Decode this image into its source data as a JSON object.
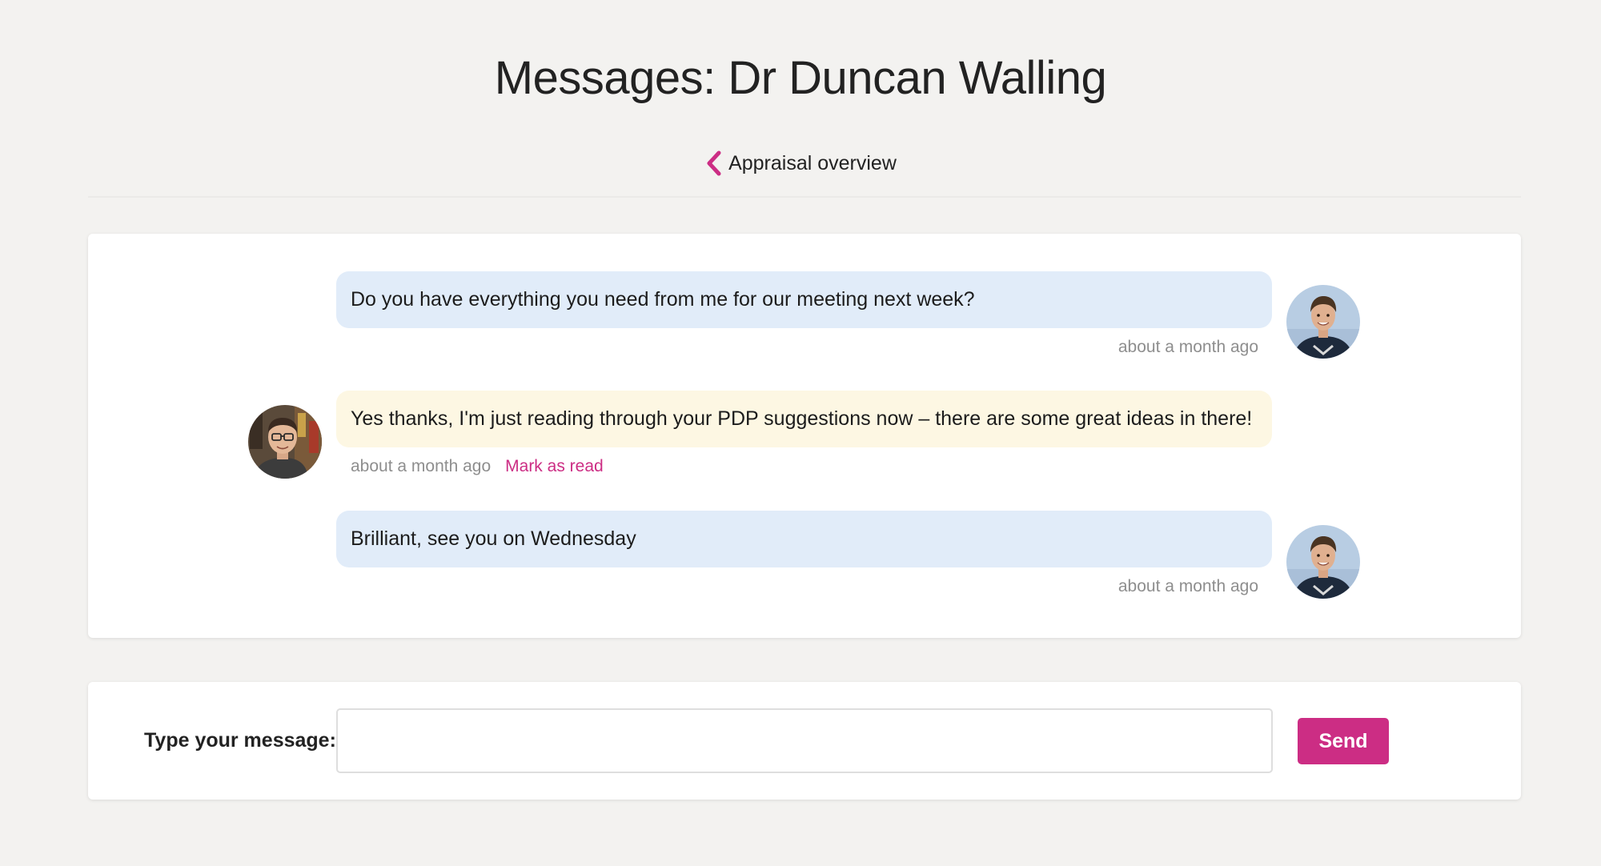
{
  "header": {
    "title": "Messages: Dr Duncan Walling",
    "back_link_label": "Appraisal overview",
    "back_icon": "chevron-left-icon"
  },
  "messages": [
    {
      "direction": "sent",
      "text": "Do you have everything you need from me for our meeting next week?",
      "time": "about a month ago"
    },
    {
      "direction": "received",
      "text": "Yes thanks, I'm just reading through your PDP suggestions now – there are some great ideas in there!",
      "time": "about a month ago",
      "action_label": "Mark as read"
    },
    {
      "direction": "sent",
      "text": "Brilliant, see you on Wednesday",
      "time": "about a month ago"
    }
  ],
  "compose": {
    "label": "Type your message:",
    "value": "",
    "placeholder": "",
    "send_label": "Send"
  },
  "colors": {
    "background": "#f3f2f0",
    "accent": "#cc2d84",
    "sent_bubble": "#e1ecf9",
    "received_bubble": "#fdf7e3",
    "meta_text": "#8e8e8e"
  }
}
